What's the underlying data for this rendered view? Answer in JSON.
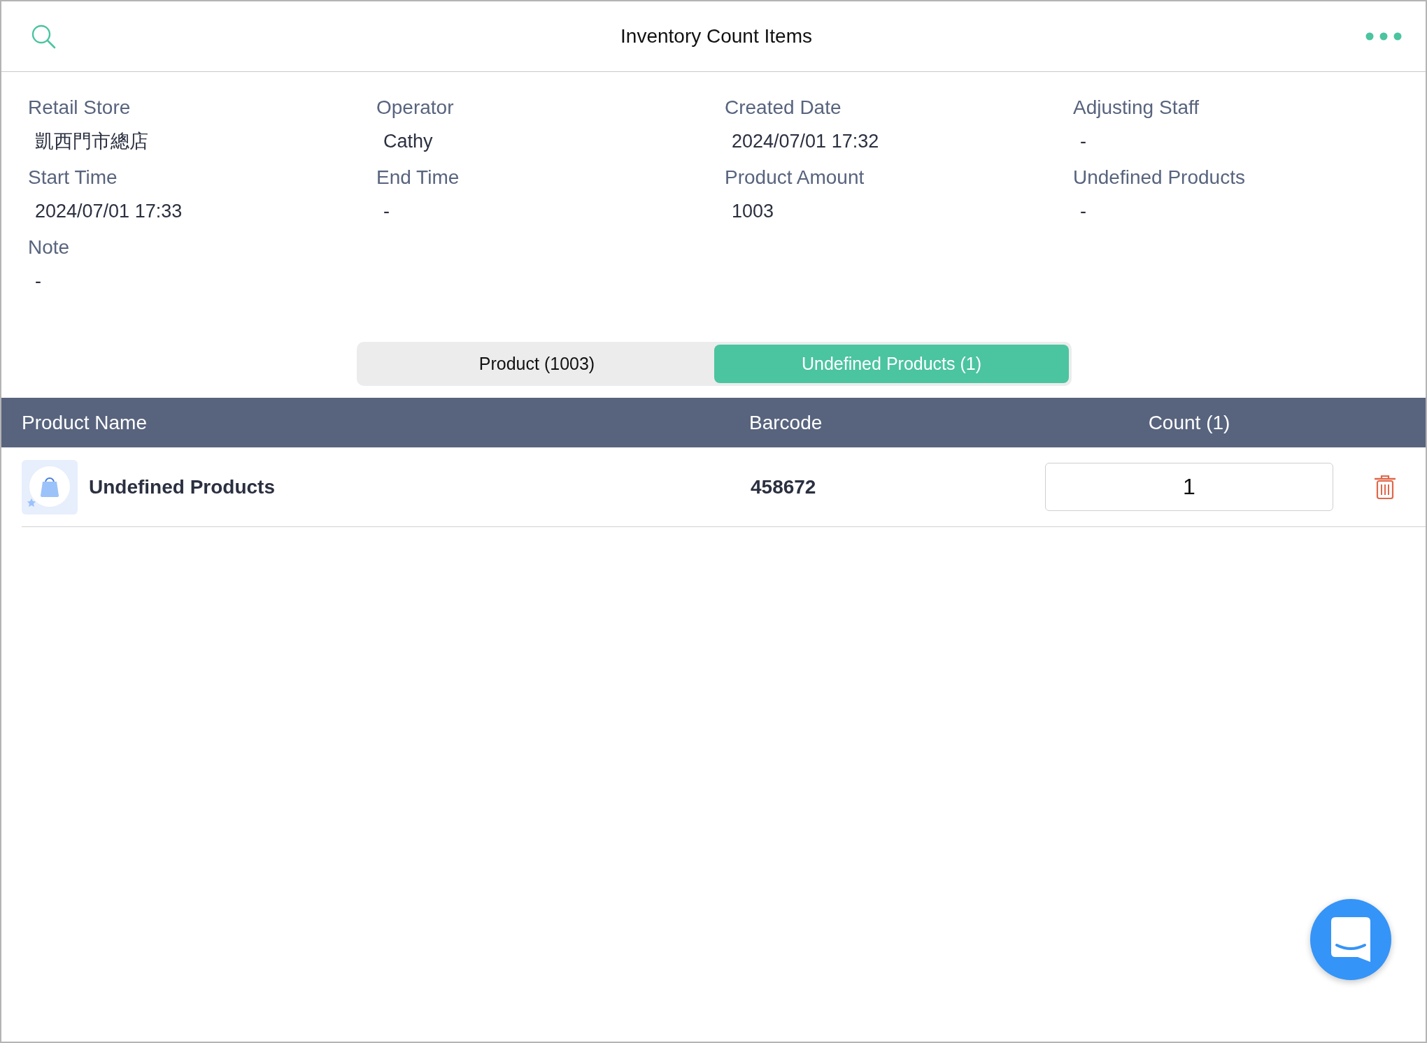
{
  "header": {
    "title": "Inventory Count Items"
  },
  "details": [
    {
      "label": "Retail Store",
      "value": "凱西門市總店"
    },
    {
      "label": "Operator",
      "value": "Cathy"
    },
    {
      "label": "Created Date",
      "value": "2024/07/01 17:32"
    },
    {
      "label": "Adjusting Staff",
      "value": "-"
    },
    {
      "label": "Start Time",
      "value": "2024/07/01 17:33"
    },
    {
      "label": "End Time",
      "value": "-"
    },
    {
      "label": "Product Amount",
      "value": "1003"
    },
    {
      "label": "Undefined Products",
      "value": "-"
    },
    {
      "label": "Note",
      "value": "-"
    }
  ],
  "segments": [
    {
      "label": "Product (1003)",
      "selected": false
    },
    {
      "label": "Undefined Products (1)",
      "selected": true
    }
  ],
  "table": {
    "columns": [
      "Product Name",
      "Barcode",
      "Count (1)"
    ],
    "rows": [
      {
        "name": "Undefined Products",
        "barcode": "458672",
        "count": "1"
      }
    ]
  }
}
